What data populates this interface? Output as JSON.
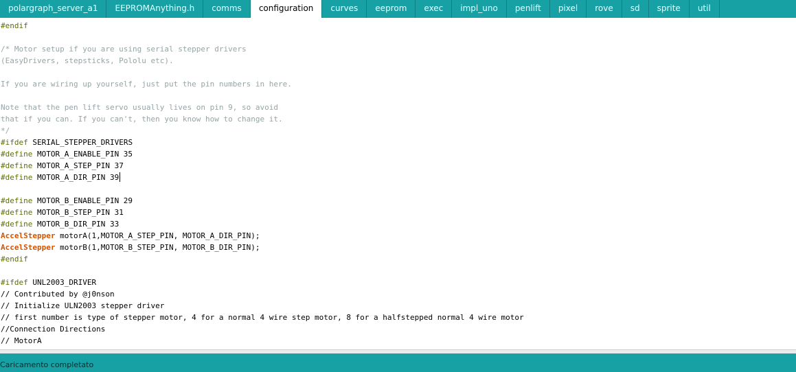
{
  "tabs": [
    {
      "label": "polargraph_server_a1",
      "active": false
    },
    {
      "label": "EEPROMAnything.h",
      "active": false
    },
    {
      "label": "comms",
      "active": false
    },
    {
      "label": "configuration",
      "active": true
    },
    {
      "label": "curves",
      "active": false
    },
    {
      "label": "eeprom",
      "active": false
    },
    {
      "label": "exec",
      "active": false
    },
    {
      "label": "impl_uno",
      "active": false
    },
    {
      "label": "penlift",
      "active": false
    },
    {
      "label": "pixel",
      "active": false
    },
    {
      "label": "rove",
      "active": false
    },
    {
      "label": "sd",
      "active": false
    },
    {
      "label": "sprite",
      "active": false
    },
    {
      "label": "util",
      "active": false
    }
  ],
  "code_lines": [
    [
      {
        "t": "#endif",
        "c": "preproc"
      }
    ],
    [],
    [
      {
        "t": "/* Motor setup if you are using serial stepper drivers",
        "c": "comment"
      }
    ],
    [
      {
        "t": "(EasyDrivers, stepsticks, Pololu etc).",
        "c": "comment"
      }
    ],
    [],
    [
      {
        "t": "If you are wiring up yourself, just put the pin numbers in here.",
        "c": "comment"
      }
    ],
    [],
    [
      {
        "t": "Note that the pen lift servo usually lives on pin 9, so avoid",
        "c": "comment"
      }
    ],
    [
      {
        "t": "that if you can. If you can't, then you know how to change it.",
        "c": "comment"
      }
    ],
    [
      {
        "t": "*/",
        "c": "comment"
      }
    ],
    [
      {
        "t": "#ifdef",
        "c": "preproc"
      },
      {
        "t": " SERIAL_STEPPER_DRIVERS",
        "c": "plain"
      }
    ],
    [
      {
        "t": "#define",
        "c": "preproc"
      },
      {
        "t": " MOTOR_A_ENABLE_PIN 35",
        "c": "plain"
      }
    ],
    [
      {
        "t": "#define",
        "c": "preproc"
      },
      {
        "t": " MOTOR_A_STEP_PIN 37",
        "c": "plain"
      }
    ],
    [
      {
        "t": "#define",
        "c": "preproc"
      },
      {
        "t": " MOTOR_A_DIR_PIN 39",
        "c": "plain"
      },
      {
        "caret": true
      }
    ],
    [],
    [
      {
        "t": "#define",
        "c": "preproc"
      },
      {
        "t": " MOTOR_B_ENABLE_PIN 29",
        "c": "plain"
      }
    ],
    [
      {
        "t": "#define",
        "c": "preproc"
      },
      {
        "t": " MOTOR_B_STEP_PIN 31",
        "c": "plain"
      }
    ],
    [
      {
        "t": "#define",
        "c": "preproc"
      },
      {
        "t": " MOTOR_B_DIR_PIN 33",
        "c": "plain"
      }
    ],
    [
      {
        "t": "AccelStepper",
        "c": "type"
      },
      {
        "t": " motorA(1,MOTOR_A_STEP_PIN, MOTOR_A_DIR_PIN);",
        "c": "plain"
      }
    ],
    [
      {
        "t": "AccelStepper",
        "c": "type"
      },
      {
        "t": " motorB(1,MOTOR_B_STEP_PIN, MOTOR_B_DIR_PIN);",
        "c": "plain"
      }
    ],
    [
      {
        "t": "#endif",
        "c": "preproc"
      }
    ],
    [],
    [
      {
        "t": "#ifdef",
        "c": "preproc"
      },
      {
        "t": " UNL2003_DRIVER",
        "c": "plain"
      }
    ],
    [
      {
        "t": "// Contributed by @j0nson",
        "c": "plain"
      }
    ],
    [
      {
        "t": "// Initialize ULN2003 stepper driver",
        "c": "plain"
      }
    ],
    [
      {
        "t": "// first number is type of stepper motor, 4 for a normal 4 wire step motor, 8 for a halfstepped normal 4 wire motor",
        "c": "plain"
      }
    ],
    [
      {
        "t": "//Connection Directions",
        "c": "plain"
      }
    ],
    [
      {
        "t": "// MotorA",
        "c": "plain"
      }
    ]
  ],
  "status": {
    "message": "Caricamento completato"
  },
  "colors": {
    "accent": "#17a1a5",
    "comment": "#95a5a6",
    "preproc": "#5e6d03",
    "type": "#d35400"
  }
}
